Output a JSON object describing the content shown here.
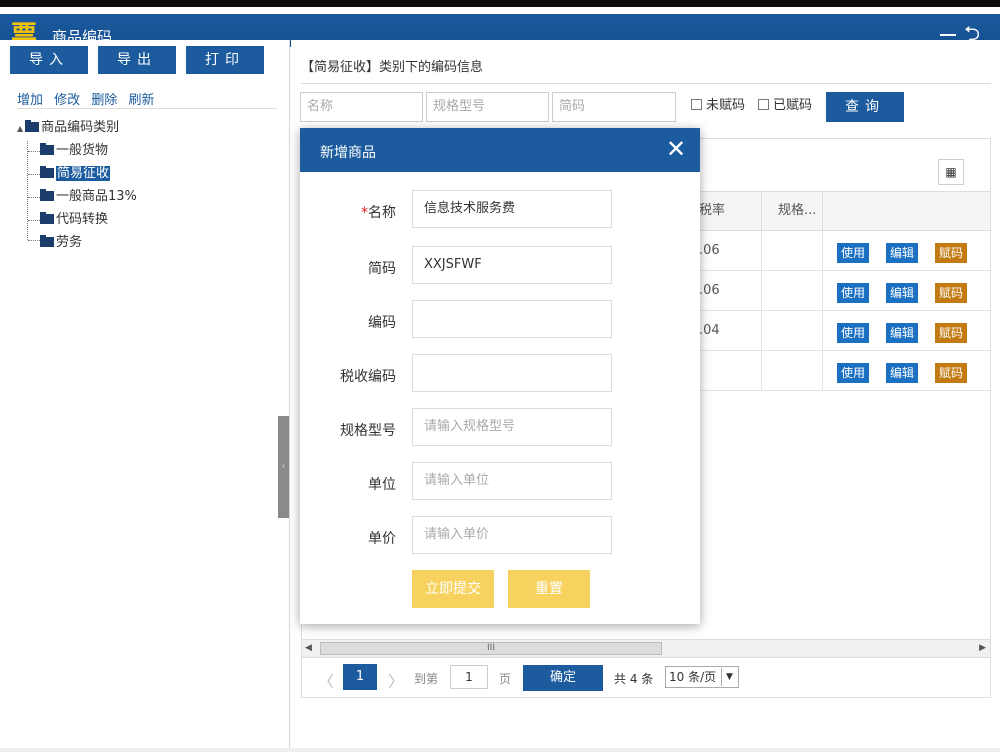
{
  "window": {
    "logo_char": "票",
    "title": "商品编码",
    "back_glyph": "⮌"
  },
  "left": {
    "buttons": {
      "import": "导入",
      "export": "导出",
      "print": "打印"
    },
    "links": [
      "增加",
      "修改",
      "删除",
      "刷新"
    ],
    "tree": {
      "root": "商品编码类别",
      "root_toggle": "▲",
      "children": [
        "一般货物",
        "简易征收",
        "一般商品13%",
        "代码转换",
        "劳务"
      ],
      "selected_index": 1
    }
  },
  "right": {
    "title": "【简易征收】类别下的编码信息",
    "filters": {
      "name_placeholder": "名称",
      "spec_placeholder": "规格型号",
      "abbr_placeholder": "简码",
      "unassigned_label": "未赋码",
      "assigned_label": "已赋码",
      "query_button": "查询"
    },
    "table": {
      "columns": [
        "税率",
        "规格..."
      ],
      "rows": [
        {
          "tax_rate": ".06",
          "spec": ""
        },
        {
          "tax_rate": ".06",
          "spec": ""
        },
        {
          "tax_rate": ".04",
          "spec": ""
        },
        {
          "tax_rate": "",
          "spec": ""
        }
      ],
      "actions": {
        "use": "使用",
        "edit": "编辑",
        "assign": "赋码"
      },
      "grid_icon_glyph": "▦",
      "scroll_thumb": "III"
    },
    "pager": {
      "prev": "〈",
      "next": "〉",
      "current_page": "1",
      "goto_label": "到第",
      "goto_value": "1",
      "page_label": "页",
      "ok_button": "确定",
      "total": "共 4 条",
      "page_size": "10 条/页"
    }
  },
  "modal": {
    "title": "新增商品",
    "close_glyph": "✕",
    "required_mark": "*",
    "fields": {
      "name": {
        "label": "名称",
        "value": "信息技术服务费"
      },
      "abbr": {
        "label": "简码",
        "value": "XXJSFWF"
      },
      "code": {
        "label": "编码",
        "value": ""
      },
      "tax_code": {
        "label": "税收编码",
        "value": ""
      },
      "spec": {
        "label": "规格型号",
        "placeholder": "请输入规格型号"
      },
      "unit": {
        "label": "单位",
        "placeholder": "请输入单位"
      },
      "price": {
        "label": "单价",
        "placeholder": "请输入单价"
      }
    },
    "submit_button": "立即提交",
    "reset_button": "重置"
  },
  "colors": {
    "primary": "#1b5b9e",
    "action_blue": "#1b70c2",
    "action_orange": "#c37a12",
    "submit_yellow": "#f7d25f",
    "logo_gold": "#f2c20a"
  }
}
